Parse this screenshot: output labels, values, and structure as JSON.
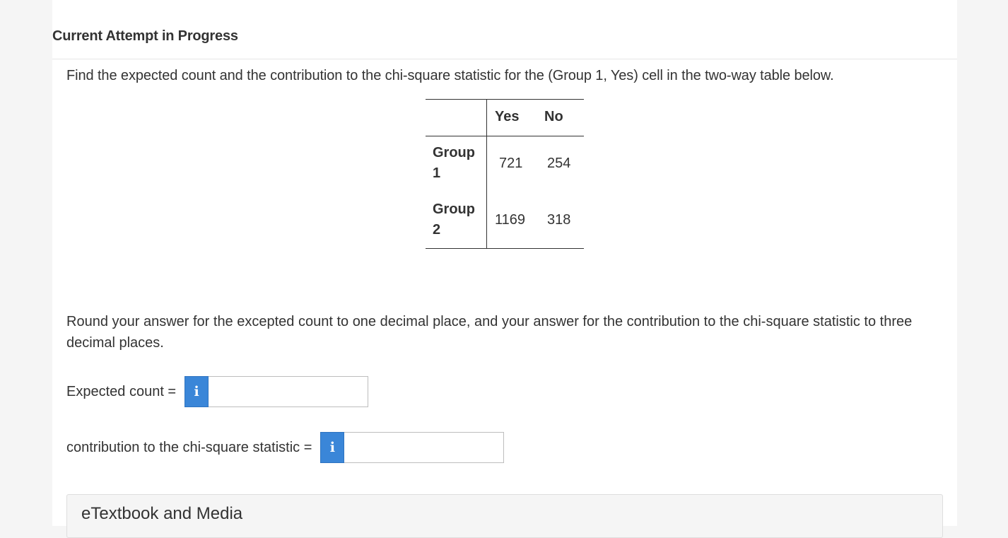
{
  "header": {
    "title": "Current Attempt in Progress"
  },
  "question": {
    "text": "Find the expected count and the contribution to the chi-square statistic for the (Group 1, Yes) cell in the two-way table below."
  },
  "table": {
    "columns": [
      "Yes",
      "No"
    ],
    "rows": [
      {
        "label": "Group 1",
        "values": [
          "721",
          "254"
        ]
      },
      {
        "label": "Group 2",
        "values": [
          "1169",
          "318"
        ]
      }
    ]
  },
  "instructions": {
    "text": "Round your answer for the excepted count to one decimal place, and your answer for the contribution to the chi-square statistic to three decimal places."
  },
  "fields": {
    "expected": {
      "label": "Expected count =",
      "value": ""
    },
    "contribution": {
      "label": "contribution to the chi-square statistic =",
      "value": ""
    },
    "info_glyph": "i"
  },
  "media": {
    "title": "eTextbook and Media"
  },
  "colors": {
    "info_button": "#3a86d8",
    "page_background": "#f5f5f5",
    "panel_background": "#ffffff"
  }
}
